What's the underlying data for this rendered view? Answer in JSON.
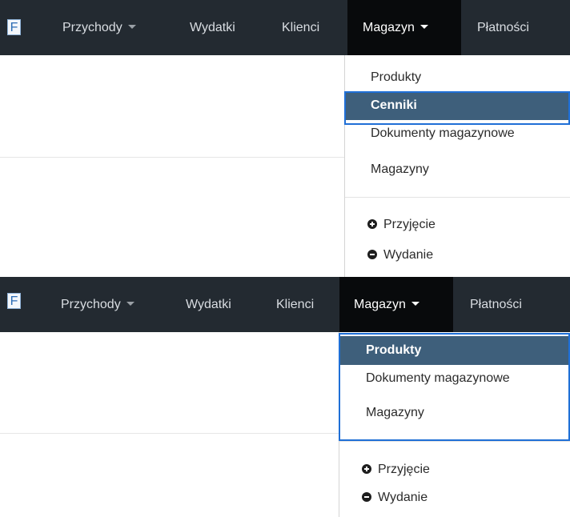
{
  "nav": {
    "logo_letter": "F",
    "items": [
      {
        "label": "Przychody",
        "has_caret": true
      },
      {
        "label": "Wydatki",
        "has_caret": false
      },
      {
        "label": "Klienci",
        "has_caret": false
      },
      {
        "label": "Magazyn",
        "has_caret": true,
        "active": true
      },
      {
        "label": "Płatności",
        "has_caret": false
      }
    ]
  },
  "dropdown_top": {
    "items": [
      "Produkty",
      "Cenniki",
      "Dokumenty magazynowe",
      "Magazyny"
    ],
    "highlighted": "Cenniki",
    "actions": [
      {
        "label": "Przyjęcie",
        "icon": "plus-circle-icon"
      },
      {
        "label": "Wydanie",
        "icon": "minus-circle-icon"
      }
    ]
  },
  "dropdown_bottom": {
    "items": [
      "Produkty",
      "Dokumenty magazynowe",
      "Magazyny"
    ],
    "highlighted": "Produkty",
    "actions": [
      {
        "label": "Przyjęcie",
        "icon": "plus-circle-icon"
      },
      {
        "label": "Wydanie",
        "icon": "minus-circle-icon"
      }
    ]
  },
  "colors": {
    "navbar": "#232a31",
    "active_nav": "#080a0c",
    "highlight": "#3e5f7b",
    "focus_outline": "#1f6fd6"
  }
}
